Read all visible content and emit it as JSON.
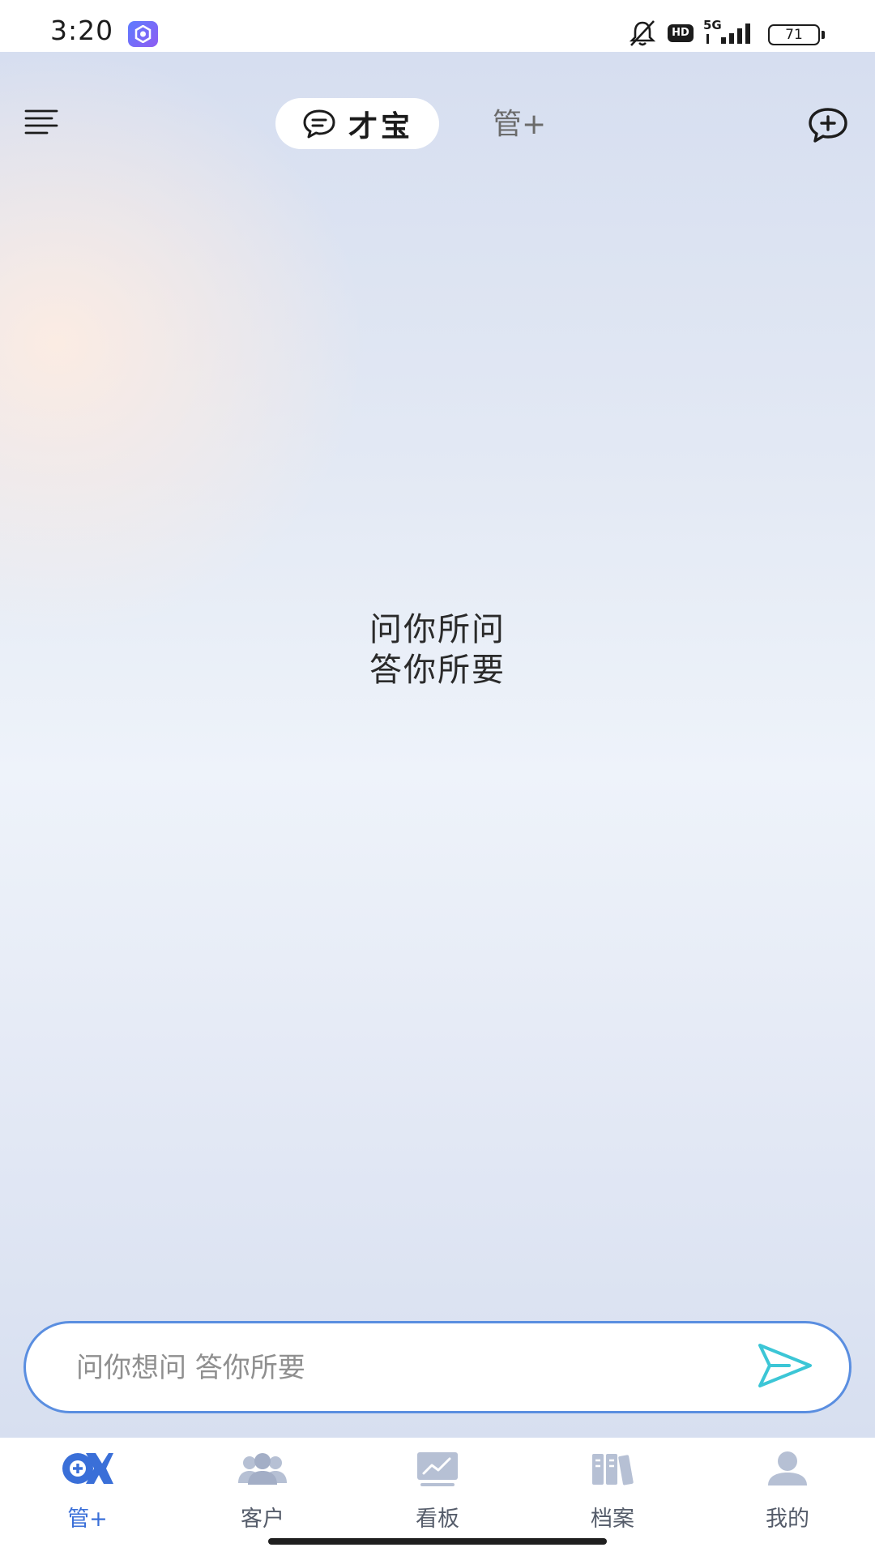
{
  "status_bar": {
    "time": "3:20",
    "network": "5G",
    "hd": "HD",
    "battery": "71",
    "icons": [
      "app-icon",
      "bell-muted-icon",
      "hd-icon",
      "signal-5g-icon",
      "battery-icon"
    ]
  },
  "header": {
    "menu_icon": "hamburger-menu-icon",
    "tabs": [
      {
        "label": "才宝",
        "icon": "chat-bubble-icon",
        "active": true
      },
      {
        "label": "管+",
        "active": false
      }
    ],
    "new_chat_icon": "chat-plus-icon"
  },
  "main": {
    "slogan_line1": "问你所问",
    "slogan_line2": "答你所要"
  },
  "chat_input": {
    "placeholder": "问你想问 答你所要",
    "value": "",
    "send_icon": "send-icon"
  },
  "bottom_nav": {
    "items": [
      {
        "label": "管+",
        "icon": "guan-plus-logo-icon",
        "active": true
      },
      {
        "label": "客户",
        "icon": "customers-icon",
        "active": false
      },
      {
        "label": "看板",
        "icon": "dashboard-chart-icon",
        "active": false
      },
      {
        "label": "档案",
        "icon": "archive-books-icon",
        "active": false
      },
      {
        "label": "我的",
        "icon": "profile-icon",
        "active": false
      }
    ]
  },
  "colors": {
    "accent": "#3a6fd8",
    "input_border": "#5a8ee0",
    "send_icon": "#3cc6d6",
    "inactive_icon": "#b6c0d4"
  }
}
